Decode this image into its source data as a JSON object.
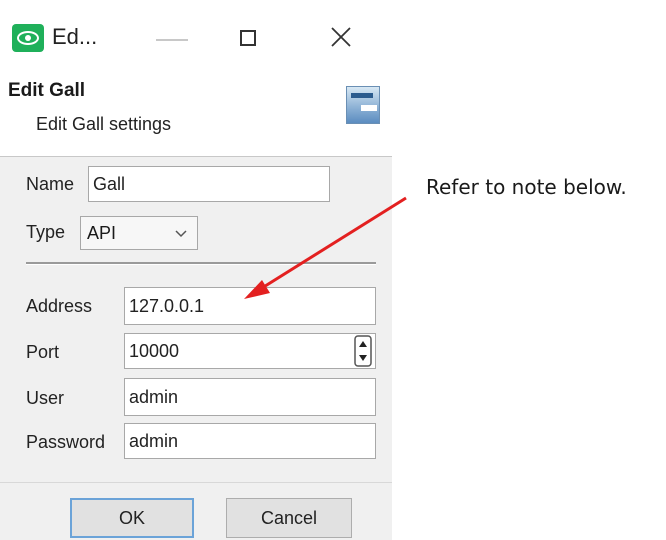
{
  "window": {
    "title": "Ed...",
    "controls": [
      "minimize-icon",
      "maximize-icon",
      "close-icon"
    ]
  },
  "header": {
    "title": "Edit Gall",
    "subtitle": "Edit Gall settings"
  },
  "form": {
    "name_label": "Name",
    "name_value": "Gall",
    "type_label": "Type",
    "type_value": "API",
    "address_label": "Address",
    "address_value": "127.0.0.1",
    "port_label": "Port",
    "port_value": "10000",
    "user_label": "User",
    "user_value": "admin",
    "password_label": "Password",
    "password_value": "admin"
  },
  "buttons": {
    "ok_label": "OK",
    "cancel_label": "Cancel"
  },
  "annotation": {
    "note_text": "Refer to note below.",
    "arrow_color": "#e32020"
  },
  "colors": {
    "app_icon": "#1fb05a",
    "ok_border": "#6ba3d8"
  }
}
